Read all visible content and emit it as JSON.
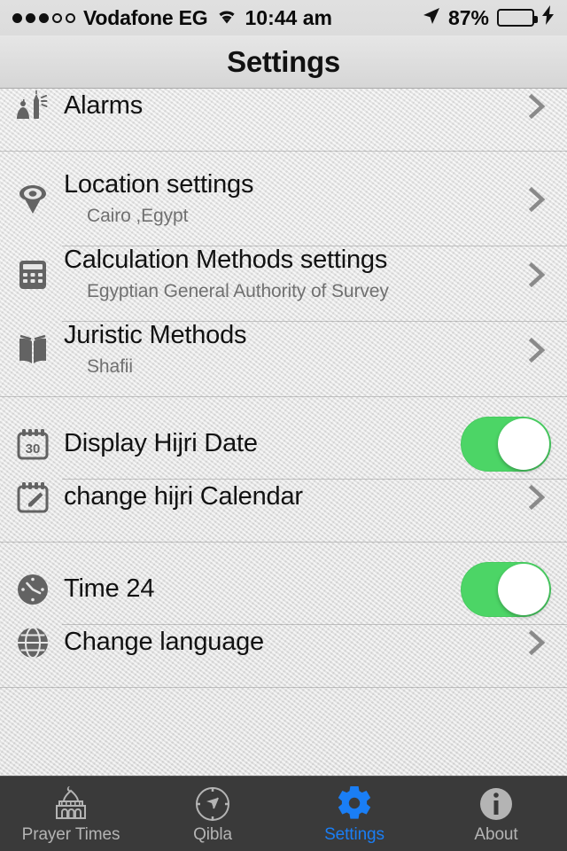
{
  "status_bar": {
    "signal_dots_total": 5,
    "signal_dots_filled": 3,
    "carrier": "Vodafone EG",
    "wifi_icon": "wifi-icon",
    "time": "10:44 am",
    "location_icon": "location-arrow-icon",
    "battery_percent": "87%",
    "battery_level": 85,
    "charging_icon": "lightning-bolt-icon",
    "battery_color": "#4cd964"
  },
  "navbar": {
    "title": "Settings"
  },
  "sections": [
    {
      "rows": [
        {
          "icon": "mosque-minaret-icon",
          "title": "Alarms",
          "subtitle": "",
          "accessory": "chevron"
        }
      ]
    },
    {
      "rows": [
        {
          "icon": "location-pin-eye-icon",
          "title": "Location settings",
          "subtitle": "Cairo ,Egypt",
          "accessory": "chevron"
        },
        {
          "icon": "calculator-icon",
          "title": "Calculation Methods settings",
          "subtitle": "Egyptian General Authority of Survey",
          "accessory": "chevron"
        },
        {
          "icon": "open-book-icon",
          "title": "Juristic Methods",
          "subtitle": "Shafii",
          "accessory": "chevron"
        }
      ]
    },
    {
      "rows": [
        {
          "icon": "calendar-30-icon",
          "title": "Display Hijri Date",
          "subtitle": "",
          "accessory": "toggle",
          "toggle_on": true
        },
        {
          "icon": "calendar-pencil-icon",
          "title": "change hijri Calendar",
          "subtitle": "",
          "accessory": "chevron"
        }
      ]
    },
    {
      "rows": [
        {
          "icon": "clock-icon",
          "title": "Time 24",
          "subtitle": "",
          "accessory": "toggle",
          "toggle_on": true
        },
        {
          "icon": "globe-icon",
          "title": "Change language",
          "subtitle": "",
          "accessory": "chevron"
        }
      ]
    }
  ],
  "tabbar": {
    "active_color": "#1a7ef5",
    "inactive_color": "#b4b4b4",
    "tabs": [
      {
        "icon": "mosque-icon",
        "label": "Prayer Times",
        "active": false
      },
      {
        "icon": "compass-icon",
        "label": "Qibla",
        "active": false
      },
      {
        "icon": "gear-icon",
        "label": "Settings",
        "active": true
      },
      {
        "icon": "info-circle-icon",
        "label": "About",
        "active": false
      }
    ]
  }
}
